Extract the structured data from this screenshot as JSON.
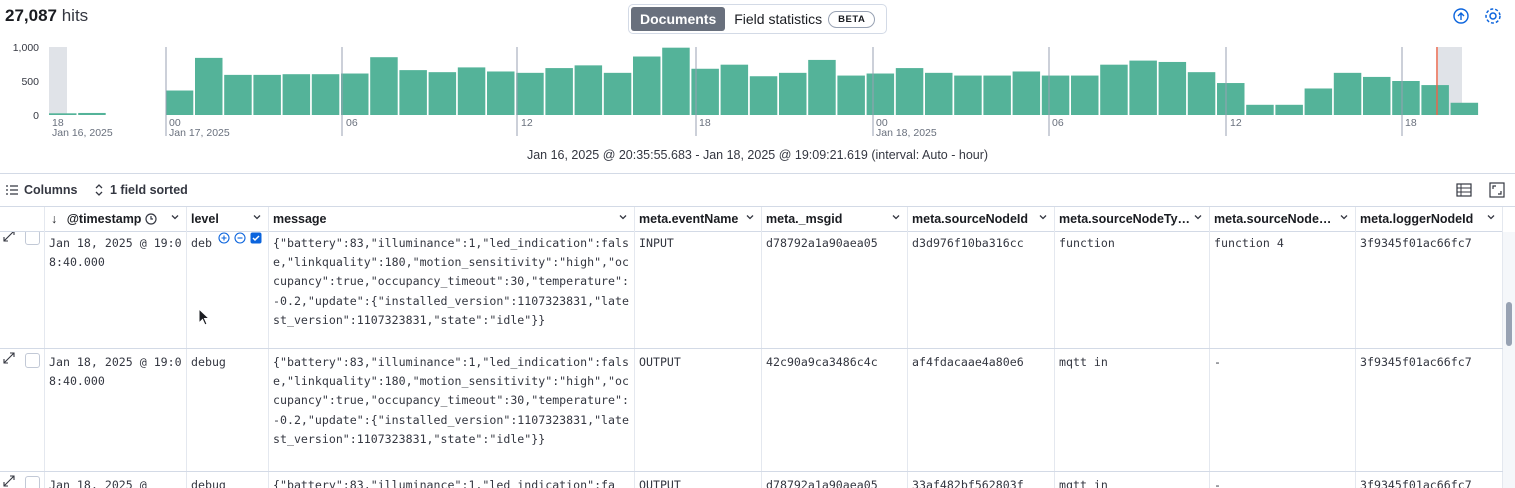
{
  "header": {
    "hits_count": "27,087",
    "hits_label": " hits",
    "tabs": [
      {
        "label": "Documents",
        "active": true
      },
      {
        "label": "Field statistics",
        "badge": "BETA",
        "active": false
      }
    ],
    "icons": [
      "ai-assistant-icon",
      "gear-icon"
    ]
  },
  "histogram": {
    "y_ticks": [
      "1,000",
      "500",
      "0"
    ],
    "x_ticks": [
      "18",
      "Jan 16, 2025",
      "00",
      "Jan 17, 2025",
      "06",
      "12",
      "18",
      "00",
      "Jan 18, 2025",
      "06",
      "12",
      "18"
    ],
    "bar_color": "#54b399",
    "now_marker_color": "#e7664c",
    "time_range": "Jan 16, 2025 @ 20:35:55.683 - Jan 18, 2025 @ 19:09:21.619 (interval: Auto - hour)"
  },
  "chart_data": {
    "type": "bar",
    "xlabel": "",
    "ylabel": "",
    "ylim": [
      0,
      1000
    ],
    "values": [
      25,
      30,
      0,
      0,
      360,
      840,
      590,
      590,
      600,
      600,
      610,
      850,
      660,
      630,
      700,
      640,
      620,
      690,
      730,
      620,
      860,
      990,
      680,
      740,
      570,
      620,
      810,
      580,
      610,
      690,
      620,
      580,
      580,
      640,
      580,
      580,
      740,
      800,
      780,
      630,
      470,
      150,
      150,
      390,
      620,
      560,
      500,
      440,
      180
    ]
  },
  "toolbar": {
    "columns_label": "Columns",
    "sort_label": "1 field sorted"
  },
  "table": {
    "columns": [
      "@timestamp",
      "level",
      "message",
      "meta.eventName",
      "meta._msgid",
      "meta.sourceNodeId",
      "meta.sourceNodeTy…",
      "meta.sourceNode…",
      "meta.loggerNodeId"
    ],
    "rows": [
      {
        "timestamp": "Jan 18, 2025 @ 19:08:40.000",
        "level": "deb",
        "message": "{\"battery\":83,\"illuminance\":1,\"led_indication\":false,\"linkquality\":180,\"motion_sensitivity\":\"high\",\"occupancy\":true,\"occupancy_timeout\":30,\"temperature\":-0.2,\"update\":{\"installed_version\":1107323831,\"latest_version\":1107323831,\"state\":\"idle\"}}",
        "eventName": "INPUT",
        "msgid": "d78792a1a90aea05",
        "sourceNodeId": "d3d976f10ba316cc",
        "sourceNodeType": "function",
        "sourceNode": "function 4",
        "loggerNodeId": "3f9345f01ac66fc7"
      },
      {
        "timestamp": "Jan 18, 2025 @ 19:08:40.000",
        "level": "debug",
        "message": "{\"battery\":83,\"illuminance\":1,\"led_indication\":false,\"linkquality\":180,\"motion_sensitivity\":\"high\",\"occupancy\":true,\"occupancy_timeout\":30,\"temperature\":-0.2,\"update\":{\"installed_version\":1107323831,\"latest_version\":1107323831,\"state\":\"idle\"}}",
        "eventName": "OUTPUT",
        "msgid": "42c90a9ca3486c4c",
        "sourceNodeId": "af4fdacaae4a80e6",
        "sourceNodeType": "mqtt in",
        "sourceNode": "-",
        "loggerNodeId": "3f9345f01ac66fc7"
      },
      {
        "timestamp": "Jan 18, 2025 @",
        "level": "debug",
        "message": "{\"battery\":83,\"illuminance\":1,\"led_indication\":fa",
        "eventName": "OUTPUT",
        "msgid": "d78792a1a90aea05",
        "sourceNodeId": "33af482bf562803f",
        "sourceNodeType": "mqtt in",
        "sourceNode": "-",
        "loggerNodeId": "3f9345f01ac66fc7"
      }
    ]
  }
}
